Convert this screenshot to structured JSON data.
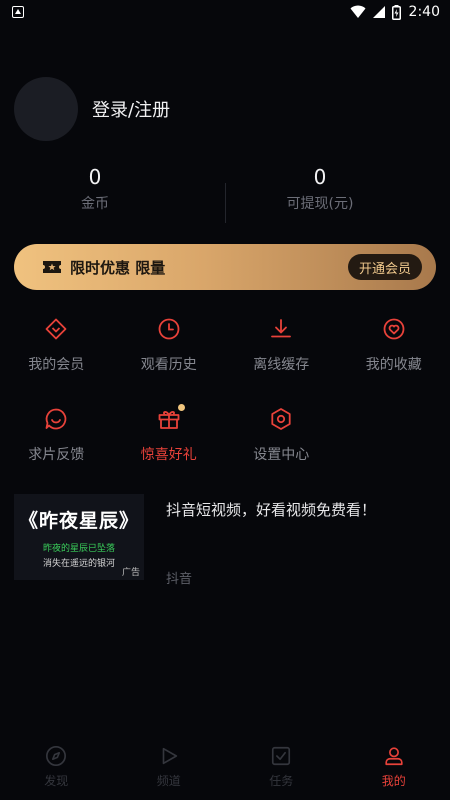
{
  "status_bar": {
    "time": "2:40"
  },
  "profile": {
    "login_text": "登录/注册"
  },
  "stats": [
    {
      "value": "0",
      "label": "金币"
    },
    {
      "value": "0",
      "label": "可提现(元)"
    }
  ],
  "vip_banner": {
    "text": "限时优惠 限量",
    "button": "开通会员"
  },
  "features": [
    {
      "label": "我的会员",
      "icon": "vip-diamond-icon"
    },
    {
      "label": "观看历史",
      "icon": "clock-icon"
    },
    {
      "label": "离线缓存",
      "icon": "download-icon"
    },
    {
      "label": "我的收藏",
      "icon": "heart-icon"
    },
    {
      "label": "求片反馈",
      "icon": "chat-icon"
    },
    {
      "label": "惊喜好礼",
      "icon": "gift-icon"
    },
    {
      "label": "设置中心",
      "icon": "hexagon-settings-icon"
    }
  ],
  "ad": {
    "thumb_title": "《昨夜星辰》",
    "thumb_line1": "昨夜的星辰已坠落",
    "thumb_line2": "消失在遥远的银河",
    "tag": "广告",
    "title": "抖音短视频，好看视频免费看！",
    "source": "抖音"
  },
  "tabbar": [
    {
      "label": "发现",
      "icon": "compass-icon"
    },
    {
      "label": "频道",
      "icon": "play-icon"
    },
    {
      "label": "任务",
      "icon": "task-icon"
    },
    {
      "label": "我的",
      "icon": "user-icon",
      "active": true
    }
  ],
  "colors": {
    "accent": "#e8423a",
    "gold": "#d9a66a",
    "background": "#06070b"
  }
}
